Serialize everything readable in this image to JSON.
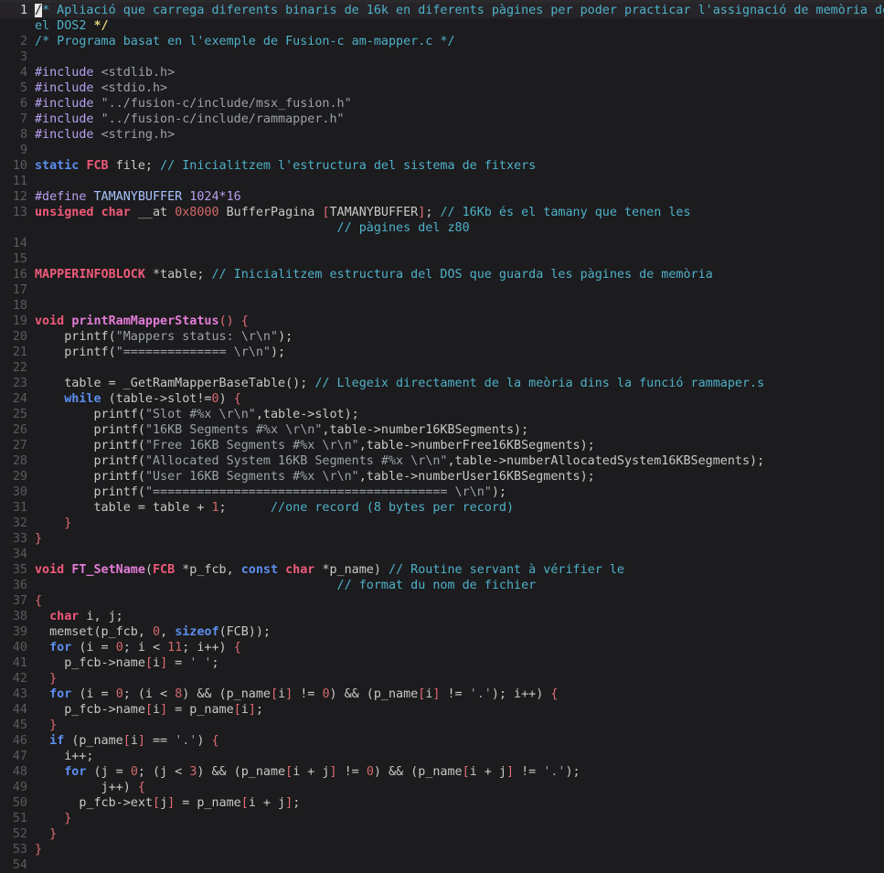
{
  "editor": {
    "current_line": 1,
    "lines": [
      {
        "n": "1",
        "tokens": [
          {
            "t": "/",
            "c": "cursor"
          },
          {
            "t": "* Apliació que carrega diferents binaris de 16k en diferents pàgines per poder practicar l'assignació de memòria de",
            "c": "cm"
          }
        ]
      },
      {
        "n": "",
        "tokens": [
          {
            "t": "el DOS2 ",
            "c": "cm"
          },
          {
            "t": "*/",
            "c": "todo"
          }
        ]
      },
      {
        "n": "2",
        "tokens": [
          {
            "t": "/* Programa basat en l'exemple de Fusion-c am-mapper.c */",
            "c": "cm"
          }
        ]
      },
      {
        "n": "3",
        "tokens": []
      },
      {
        "n": "4",
        "tokens": [
          {
            "t": "#include ",
            "c": "pp"
          },
          {
            "t": "<stdlib.h>",
            "c": "st"
          }
        ]
      },
      {
        "n": "5",
        "tokens": [
          {
            "t": "#include ",
            "c": "pp"
          },
          {
            "t": "<stdio.h>",
            "c": "st"
          }
        ]
      },
      {
        "n": "6",
        "tokens": [
          {
            "t": "#include ",
            "c": "pp"
          },
          {
            "t": "\"../fusion-c/include/msx_fusion.h\"",
            "c": "st"
          }
        ]
      },
      {
        "n": "7",
        "tokens": [
          {
            "t": "#include ",
            "c": "pp"
          },
          {
            "t": "\"../fusion-c/include/rammapper.h\"",
            "c": "st"
          }
        ]
      },
      {
        "n": "8",
        "tokens": [
          {
            "t": "#include ",
            "c": "pp"
          },
          {
            "t": "<string.h>",
            "c": "st"
          }
        ]
      },
      {
        "n": "9",
        "tokens": []
      },
      {
        "n": "10",
        "tokens": [
          {
            "t": "static ",
            "c": "kw"
          },
          {
            "t": "FCB",
            "c": "ty"
          },
          {
            "t": " file; "
          },
          {
            "t": "// Inicialitzem l'estructura del sistema de fitxers",
            "c": "cm"
          }
        ]
      },
      {
        "n": "11",
        "tokens": []
      },
      {
        "n": "12",
        "tokens": [
          {
            "t": "#define ",
            "c": "pp"
          },
          {
            "t": "TAMANYBUFFER ",
            "c": "id"
          },
          {
            "t": "1024*16",
            "c": "pp"
          }
        ]
      },
      {
        "n": "13",
        "tokens": [
          {
            "t": "unsigned ",
            "c": "ty"
          },
          {
            "t": "char",
            "c": "ty"
          },
          {
            "t": " __at "
          },
          {
            "t": "0x8000",
            "c": "nu"
          },
          {
            "t": " BufferPagina "
          },
          {
            "t": "[",
            "c": "br"
          },
          {
            "t": "TAMANYBUFFER"
          },
          {
            "t": "]",
            "c": "br"
          },
          {
            "t": "; "
          },
          {
            "t": "// 16Kb és el tamany que tenen les",
            "c": "cm"
          }
        ]
      },
      {
        "n": "",
        "tokens": [
          {
            "t": "                                         "
          },
          {
            "t": "// pàgines del z80",
            "c": "cm"
          }
        ]
      },
      {
        "n": "14",
        "tokens": []
      },
      {
        "n": "15",
        "tokens": []
      },
      {
        "n": "16",
        "tokens": [
          {
            "t": "MAPPERINFOBLOCK",
            "c": "ty"
          },
          {
            "t": " *table; "
          },
          {
            "t": "// Inicialitzem estructura del DOS que guarda les pàgines de memòria",
            "c": "cm"
          }
        ]
      },
      {
        "n": "17",
        "tokens": []
      },
      {
        "n": "18",
        "tokens": []
      },
      {
        "n": "19",
        "tokens": [
          {
            "t": "void ",
            "c": "ty"
          },
          {
            "t": "printRamMapperStatus",
            "c": "fn"
          },
          {
            "t": "() {",
            "c": "br"
          }
        ]
      },
      {
        "n": "20",
        "tokens": [
          {
            "t": "    printf("
          },
          {
            "t": "\"Mappers status: \\r\\n\"",
            "c": "st"
          },
          {
            "t": ");"
          }
        ]
      },
      {
        "n": "21",
        "tokens": [
          {
            "t": "    printf("
          },
          {
            "t": "\"============== \\r\\n\"",
            "c": "st"
          },
          {
            "t": ");"
          }
        ]
      },
      {
        "n": "22",
        "tokens": []
      },
      {
        "n": "23",
        "tokens": [
          {
            "t": "    table = _GetRamMapperBaseTable(); "
          },
          {
            "t": "// Llegeix directament de la meòria dins la funció rammaper.s",
            "c": "cm"
          }
        ]
      },
      {
        "n": "24",
        "tokens": [
          {
            "t": "    "
          },
          {
            "t": "while ",
            "c": "kw"
          },
          {
            "t": "(table->slot!="
          },
          {
            "t": "0",
            "c": "nu"
          },
          {
            "t": ") "
          },
          {
            "t": "{",
            "c": "br"
          }
        ]
      },
      {
        "n": "25",
        "tokens": [
          {
            "t": "        printf("
          },
          {
            "t": "\"Slot #%x \\r\\n\"",
            "c": "st"
          },
          {
            "t": ",table->slot);"
          }
        ]
      },
      {
        "n": "26",
        "tokens": [
          {
            "t": "        printf("
          },
          {
            "t": "\"16KB Segments #%x \\r\\n\"",
            "c": "st"
          },
          {
            "t": ",table->number16KBSegments);"
          }
        ]
      },
      {
        "n": "27",
        "tokens": [
          {
            "t": "        printf("
          },
          {
            "t": "\"Free 16KB Segments #%x \\r\\n\"",
            "c": "st"
          },
          {
            "t": ",table->numberFree16KBSegments);"
          }
        ]
      },
      {
        "n": "28",
        "tokens": [
          {
            "t": "        printf("
          },
          {
            "t": "\"Allocated System 16KB Segments #%x \\r\\n\"",
            "c": "st"
          },
          {
            "t": ",table->numberAllocatedSystem16KBSegments);"
          }
        ]
      },
      {
        "n": "29",
        "tokens": [
          {
            "t": "        printf("
          },
          {
            "t": "\"User 16KB Segments #%x \\r\\n\"",
            "c": "st"
          },
          {
            "t": ",table->numberUser16KBSegments);"
          }
        ]
      },
      {
        "n": "30",
        "tokens": [
          {
            "t": "        printf("
          },
          {
            "t": "\"======================================== \\r\\n\"",
            "c": "st"
          },
          {
            "t": ");"
          }
        ]
      },
      {
        "n": "31",
        "tokens": [
          {
            "t": "        table = table + "
          },
          {
            "t": "1",
            "c": "nu"
          },
          {
            "t": ";      "
          },
          {
            "t": "//one record (8 bytes per record)",
            "c": "cm"
          }
        ]
      },
      {
        "n": "32",
        "tokens": [
          {
            "t": "    "
          },
          {
            "t": "}",
            "c": "br"
          }
        ]
      },
      {
        "n": "33",
        "tokens": [
          {
            "t": "}",
            "c": "br"
          }
        ]
      },
      {
        "n": "34",
        "tokens": []
      },
      {
        "n": "35",
        "tokens": [
          {
            "t": "void ",
            "c": "ty"
          },
          {
            "t": "FT_SetName",
            "c": "fn"
          },
          {
            "t": "("
          },
          {
            "t": "FCB",
            "c": "ty"
          },
          {
            "t": " *p_fcb, "
          },
          {
            "t": "const ",
            "c": "kw"
          },
          {
            "t": "char",
            "c": "ty"
          },
          {
            "t": " *p_name) "
          },
          {
            "t": "// Routine servant à vérifier le",
            "c": "cm"
          }
        ]
      },
      {
        "n": "36",
        "tokens": [
          {
            "t": "                                         "
          },
          {
            "t": "// format du nom de fichier",
            "c": "cm"
          }
        ]
      },
      {
        "n": "37",
        "tokens": [
          {
            "t": "{",
            "c": "br"
          }
        ]
      },
      {
        "n": "38",
        "tokens": [
          {
            "t": "  "
          },
          {
            "t": "char",
            "c": "ty"
          },
          {
            "t": " i, j;"
          }
        ]
      },
      {
        "n": "39",
        "tokens": [
          {
            "t": "  memset(p_fcb, "
          },
          {
            "t": "0",
            "c": "nu"
          },
          {
            "t": ", "
          },
          {
            "t": "sizeof",
            "c": "kw"
          },
          {
            "t": "(FCB));"
          }
        ]
      },
      {
        "n": "40",
        "tokens": [
          {
            "t": "  "
          },
          {
            "t": "for ",
            "c": "kw"
          },
          {
            "t": "(i = "
          },
          {
            "t": "0",
            "c": "nu"
          },
          {
            "t": "; i < "
          },
          {
            "t": "11",
            "c": "nu"
          },
          {
            "t": "; i++) "
          },
          {
            "t": "{",
            "c": "br"
          }
        ]
      },
      {
        "n": "41",
        "tokens": [
          {
            "t": "    p_fcb->name"
          },
          {
            "t": "[",
            "c": "br"
          },
          {
            "t": "i"
          },
          {
            "t": "]",
            "c": "br"
          },
          {
            "t": " = "
          },
          {
            "t": "' '",
            "c": "st"
          },
          {
            "t": ";"
          }
        ]
      },
      {
        "n": "42",
        "tokens": [
          {
            "t": "  "
          },
          {
            "t": "}",
            "c": "br"
          }
        ]
      },
      {
        "n": "43",
        "tokens": [
          {
            "t": "  "
          },
          {
            "t": "for ",
            "c": "kw"
          },
          {
            "t": "(i = "
          },
          {
            "t": "0",
            "c": "nu"
          },
          {
            "t": "; (i < "
          },
          {
            "t": "8",
            "c": "nu"
          },
          {
            "t": ") && (p_name"
          },
          {
            "t": "[",
            "c": "br"
          },
          {
            "t": "i"
          },
          {
            "t": "]",
            "c": "br"
          },
          {
            "t": " != "
          },
          {
            "t": "0",
            "c": "nu"
          },
          {
            "t": ") && (p_name"
          },
          {
            "t": "[",
            "c": "br"
          },
          {
            "t": "i"
          },
          {
            "t": "]",
            "c": "br"
          },
          {
            "t": " != "
          },
          {
            "t": "'.'",
            "c": "st"
          },
          {
            "t": "); i++) "
          },
          {
            "t": "{",
            "c": "br"
          }
        ]
      },
      {
        "n": "44",
        "tokens": [
          {
            "t": "    p_fcb->name"
          },
          {
            "t": "[",
            "c": "br"
          },
          {
            "t": "i"
          },
          {
            "t": "]",
            "c": "br"
          },
          {
            "t": " = p_name"
          },
          {
            "t": "[",
            "c": "br"
          },
          {
            "t": "i"
          },
          {
            "t": "]",
            "c": "br"
          },
          {
            "t": ";"
          }
        ]
      },
      {
        "n": "45",
        "tokens": [
          {
            "t": "  "
          },
          {
            "t": "}",
            "c": "br"
          }
        ]
      },
      {
        "n": "46",
        "tokens": [
          {
            "t": "  "
          },
          {
            "t": "if ",
            "c": "kw"
          },
          {
            "t": "(p_name"
          },
          {
            "t": "[",
            "c": "br"
          },
          {
            "t": "i"
          },
          {
            "t": "]",
            "c": "br"
          },
          {
            "t": " == "
          },
          {
            "t": "'.'",
            "c": "st"
          },
          {
            "t": ") "
          },
          {
            "t": "{",
            "c": "br"
          }
        ]
      },
      {
        "n": "47",
        "tokens": [
          {
            "t": "    i++;"
          }
        ]
      },
      {
        "n": "48",
        "tokens": [
          {
            "t": "    "
          },
          {
            "t": "for ",
            "c": "kw"
          },
          {
            "t": "(j = "
          },
          {
            "t": "0",
            "c": "nu"
          },
          {
            "t": "; (j < "
          },
          {
            "t": "3",
            "c": "nu"
          },
          {
            "t": ") && (p_name"
          },
          {
            "t": "[",
            "c": "br"
          },
          {
            "t": "i + j"
          },
          {
            "t": "]",
            "c": "br"
          },
          {
            "t": " != "
          },
          {
            "t": "0",
            "c": "nu"
          },
          {
            "t": ") && (p_name"
          },
          {
            "t": "[",
            "c": "br"
          },
          {
            "t": "i + j"
          },
          {
            "t": "]",
            "c": "br"
          },
          {
            "t": " != "
          },
          {
            "t": "'.'",
            "c": "st"
          },
          {
            "t": ");"
          }
        ]
      },
      {
        "n": "49",
        "tokens": [
          {
            "t": "         j++) "
          },
          {
            "t": "{",
            "c": "br"
          }
        ]
      },
      {
        "n": "50",
        "tokens": [
          {
            "t": "      p_fcb->ext"
          },
          {
            "t": "[",
            "c": "br"
          },
          {
            "t": "j"
          },
          {
            "t": "]",
            "c": "br"
          },
          {
            "t": " = p_name"
          },
          {
            "t": "[",
            "c": "br"
          },
          {
            "t": "i + j"
          },
          {
            "t": "]",
            "c": "br"
          },
          {
            "t": ";"
          }
        ]
      },
      {
        "n": "51",
        "tokens": [
          {
            "t": "    "
          },
          {
            "t": "}",
            "c": "br"
          }
        ]
      },
      {
        "n": "52",
        "tokens": [
          {
            "t": "  "
          },
          {
            "t": "}",
            "c": "br"
          }
        ]
      },
      {
        "n": "53",
        "tokens": [
          {
            "t": "}",
            "c": "br"
          }
        ]
      },
      {
        "n": "54",
        "tokens": []
      }
    ]
  }
}
